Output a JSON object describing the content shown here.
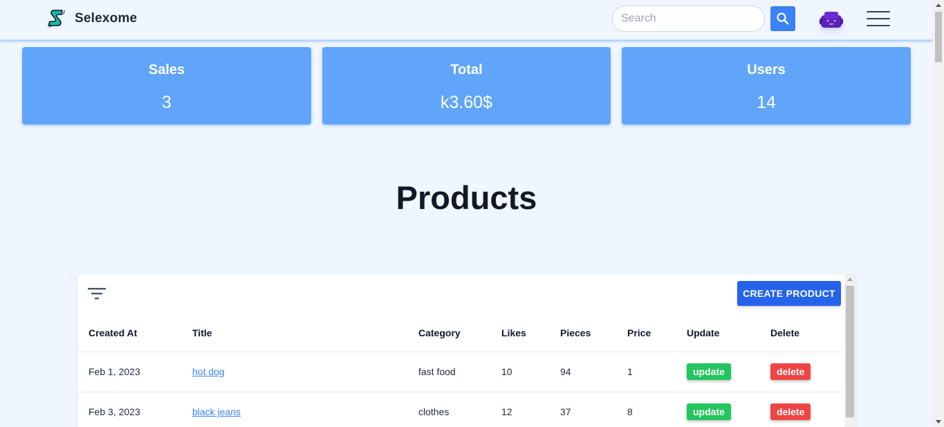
{
  "header": {
    "brand": "Selexome",
    "search_placeholder": "Search",
    "search_value": ""
  },
  "stats": [
    {
      "label": "Sales",
      "value": "3"
    },
    {
      "label": "Total",
      "value": "k3.60$"
    },
    {
      "label": "Users",
      "value": "14"
    }
  ],
  "page_title": "Products",
  "table": {
    "create_label": "CREATE PRODUCT",
    "columns": [
      "Created At",
      "Title",
      "Category",
      "Likes",
      "Pieces",
      "Price",
      "Update",
      "Delete"
    ],
    "rows": [
      {
        "created_at": "Feb 1, 2023",
        "title": "hot dog",
        "category": "fast food",
        "likes": "10",
        "pieces": "94",
        "price": "1",
        "update": "update",
        "delete": "delete"
      },
      {
        "created_at": "Feb 3, 2023",
        "title": "black jeans",
        "category": "clothes",
        "likes": "12",
        "pieces": "37",
        "price": "8",
        "update": "update",
        "delete": "delete"
      }
    ]
  },
  "colors": {
    "page_bg": "#eff6ff",
    "card_bg": "#60a5fa",
    "primary": "#2563eb",
    "update": "#22c55e",
    "delete": "#ef4444"
  },
  "icons": [
    "logo-icon",
    "search-icon",
    "avatar-icon",
    "hamburger-menu-icon",
    "filter-icon"
  ]
}
